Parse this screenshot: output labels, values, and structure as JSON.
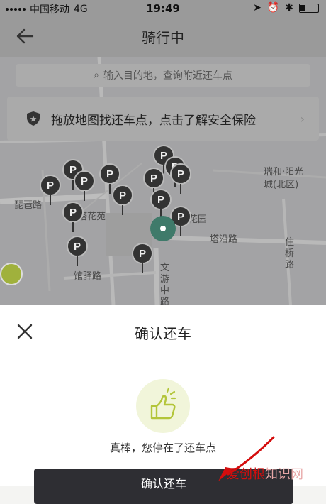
{
  "status_bar": {
    "carrier": "中国移动",
    "network": "4G",
    "time": "19:49"
  },
  "header": {
    "title": "骑行中",
    "back_icon": "arrow-left-icon"
  },
  "search": {
    "placeholder": "输入目的地，查询附近还车点"
  },
  "banner": {
    "text": "拖放地图找还车点，点击了解安全保险",
    "icon": "shield-icon"
  },
  "map": {
    "labels": [
      {
        "id": "pipa",
        "text": "琵琶路"
      },
      {
        "id": "tahuayuan",
        "text": "塔花苑"
      },
      {
        "id": "huayuan",
        "text": "花园"
      },
      {
        "id": "tayan",
        "text": "塔沿路"
      },
      {
        "id": "guanyi",
        "text": "馆驿路"
      },
      {
        "id": "wenyou",
        "text": "文游中路"
      },
      {
        "id": "ruifeng",
        "text": "瑞和·阳光城(北区)"
      },
      {
        "id": "zhuqiao",
        "text": "住桥路"
      }
    ],
    "pin_letter": "P"
  },
  "sheet": {
    "title": "确认还车",
    "message": "真棒，您停在了还车点",
    "confirm_label": "确认还车"
  },
  "watermark": {
    "part1": "爱创根",
    "part2": "知识网"
  }
}
